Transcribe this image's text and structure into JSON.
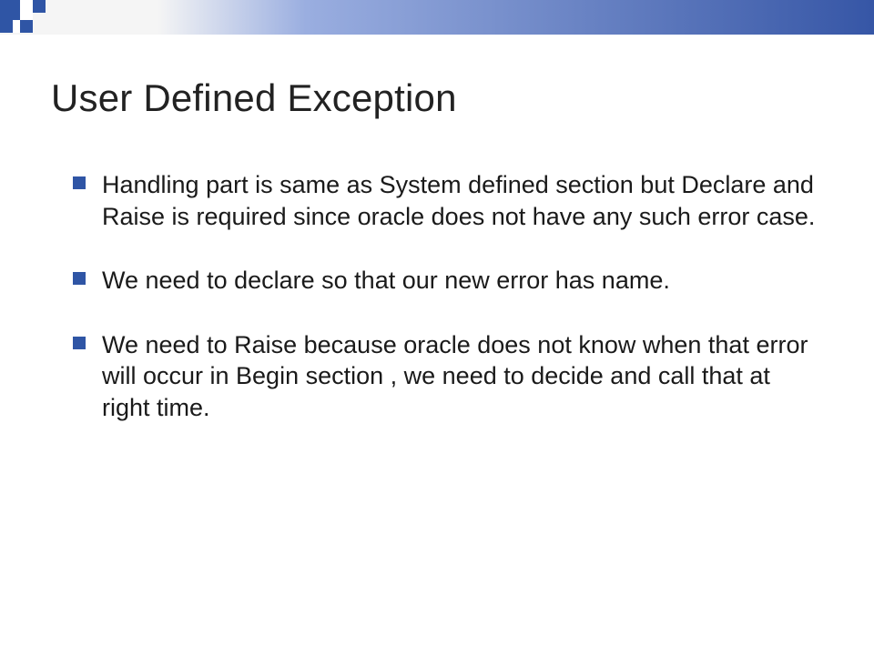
{
  "title": "User Defined Exception",
  "bullets": [
    "Handling part is same as System defined section but Declare and Raise is required since oracle does not have any such error case.",
    " We need to declare  so that our new error has name.",
    "We need to Raise because oracle does not know when that error will occur in Begin section , we need to decide and call that at right time."
  ]
}
